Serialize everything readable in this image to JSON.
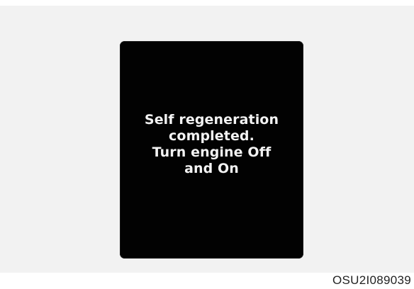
{
  "display": {
    "message_lines": [
      "Self regeneration",
      "completed.",
      "Turn engine Off",
      "and On"
    ]
  },
  "figure_code": "OSU2I089039",
  "colors": {
    "panel_background": "#f2f2f2",
    "display_background": "#020202",
    "display_text": "#f3f3f3"
  }
}
